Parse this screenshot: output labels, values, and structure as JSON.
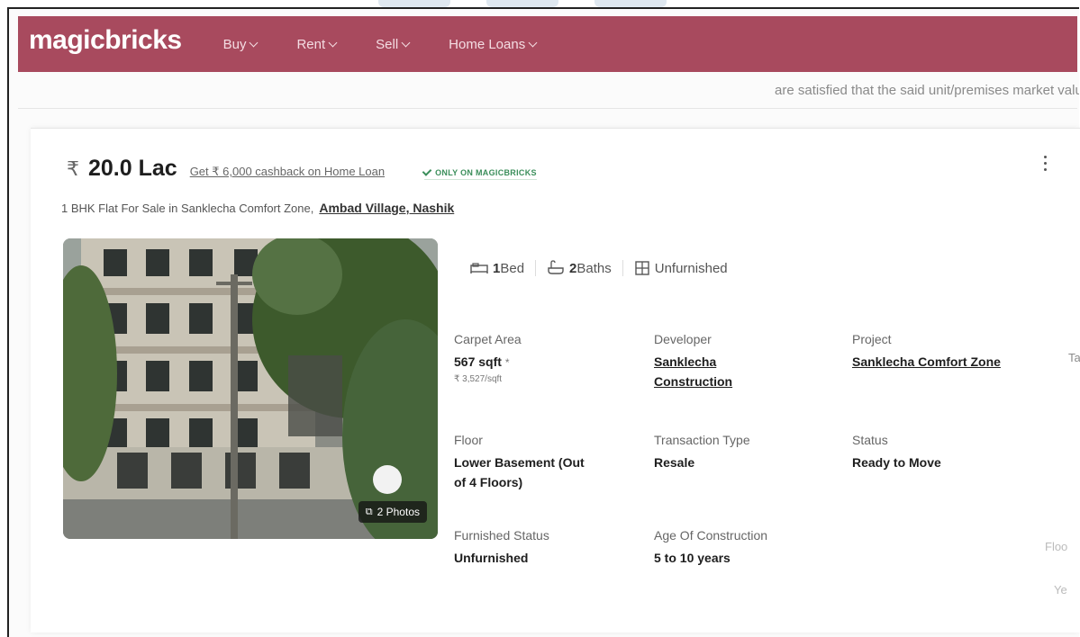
{
  "nav": {
    "logo": "magicbricks",
    "items": [
      {
        "label": "Buy"
      },
      {
        "label": "Rent"
      },
      {
        "label": "Sell"
      },
      {
        "label": "Home Loans"
      }
    ]
  },
  "background_text": {
    "behind_nav": "are satisfied that the said unit/premises market value of the property is",
    "side_labels": [
      "Ta",
      "Floo",
      "Ye"
    ]
  },
  "listing": {
    "rupee_symbol": "₹",
    "price": "20.0 Lac",
    "cashback": "Get ₹ 6,000 cashback on Home Loan",
    "badge": "ONLY ON MAGICBRICKS",
    "title": "1 BHK Flat For Sale in Sanklecha Comfort Zone,",
    "location": "Ambad Village, Nashik",
    "photos_label": "2 Photos",
    "amenities": [
      {
        "value": "1",
        "unit": "Bed",
        "icon": "bed-icon"
      },
      {
        "value": "2",
        "unit": "Baths",
        "icon": "bath-icon"
      },
      {
        "value": "",
        "unit": "Unfurnished",
        "icon": "furniture-icon"
      }
    ],
    "details": {
      "carpet_area": {
        "label": "Carpet Area",
        "value": "567 sqft",
        "marker": "*",
        "sub": "₹ 3,527/sqft"
      },
      "developer": {
        "label": "Developer",
        "value_line1": "Sanklecha",
        "value_line2": "Construction"
      },
      "project": {
        "label": "Project",
        "value": "Sanklecha Comfort Zone"
      },
      "floor": {
        "label": "Floor",
        "value_line1": "Lower Basement (Out",
        "value_line2": "of 4 Floors)"
      },
      "transaction_type": {
        "label": "Transaction Type",
        "value": "Resale"
      },
      "status": {
        "label": "Status",
        "value": "Ready to Move"
      },
      "furnished_status": {
        "label": "Furnished Status",
        "value": "Unfurnished"
      },
      "age": {
        "label": "Age Of Construction",
        "value": "5 to 10 years"
      }
    }
  },
  "colors": {
    "nav_bg": "#a84a5e",
    "badge_green": "#3a8e5a"
  }
}
